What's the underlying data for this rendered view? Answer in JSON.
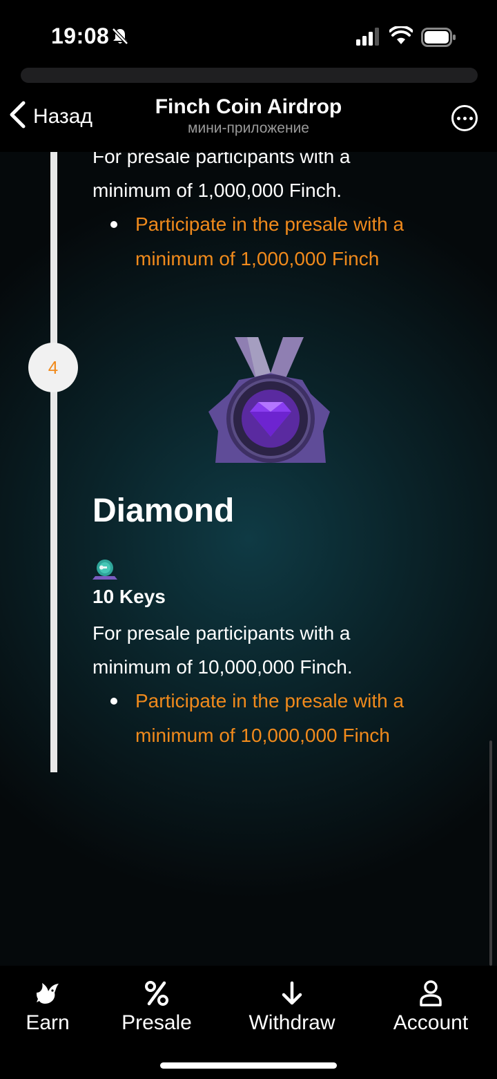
{
  "status_bar": {
    "time": "19:08"
  },
  "header": {
    "back_label": "Назад",
    "title": "Finch Coin Airdrop",
    "subtitle": "мини-приложение"
  },
  "content": {
    "prev_tier": {
      "desc_line1": "For presale participants with a",
      "desc_line2": "minimum of 1,000,000 Finch.",
      "bullet_line1": "Participate in the presale with a",
      "bullet_line2": "minimum of 1,000,000 Finch"
    },
    "tier": {
      "step_number": "4",
      "name": "Diamond",
      "keys": "10 Keys",
      "desc_line1": "For presale participants with a",
      "desc_line2": "minimum of 10,000,000 Finch.",
      "bullet_line1": "Participate in the presale with a",
      "bullet_line2": "minimum of 10,000,000 Finch"
    }
  },
  "tab_bar": {
    "tabs": [
      {
        "label": "Earn",
        "icon": "bird-icon"
      },
      {
        "label": "Presale",
        "icon": "percent-icon"
      },
      {
        "label": "Withdraw",
        "icon": "arrow-down-icon"
      },
      {
        "label": "Account",
        "icon": "user-icon"
      }
    ]
  },
  "colors": {
    "accent": "#f08a1c",
    "background": "#000000",
    "content_glow": "#0f3a44",
    "timeline": "#e8e8e8"
  }
}
